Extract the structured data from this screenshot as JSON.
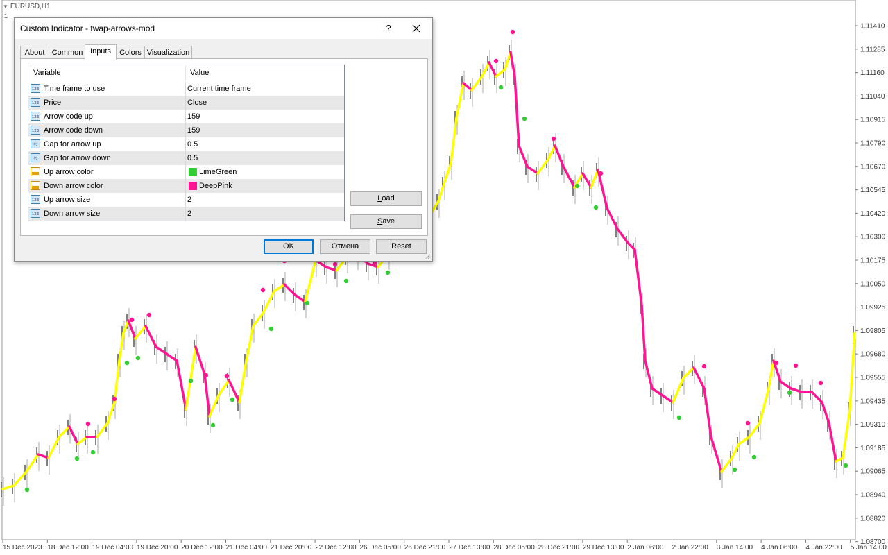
{
  "chart": {
    "symbol_title": "EURUSD,H1",
    "subwindow_label": "1",
    "colors": {
      "up": "#ffff00",
      "down": "#ff1493",
      "neutral": "#808080",
      "dot_up": "#32cd32",
      "dot_down": "#ff1493"
    },
    "price_labels": [
      "1.11410",
      "1.11285",
      "1.11160",
      "1.11040",
      "1.10915",
      "1.10790",
      "1.10670",
      "1.10545",
      "1.10420",
      "1.10300",
      "1.10175",
      "1.10050",
      "1.09925",
      "1.09805",
      "1.09680",
      "1.09555",
      "1.09435",
      "1.09310",
      "1.09185",
      "1.09065",
      "1.08940",
      "1.08820",
      "1.08700"
    ],
    "time_labels": [
      "15 Dec 2023",
      "18 Dec 12:00",
      "19 Dec 04:00",
      "19 Dec 20:00",
      "20 Dec 12:00",
      "21 Dec 04:00",
      "21 Dec 20:00",
      "22 Dec 12:00",
      "26 Dec 05:00",
      "26 Dec 21:00",
      "27 Dec 13:00",
      "28 Dec 05:00",
      "28 Dec 21:00",
      "29 Dec 13:00",
      "2 Jan 06:00",
      "2 Jan 22:00",
      "3 Jan 14:00",
      "4 Jan 06:00",
      "4 Jan 22:00",
      "5 Jan 14:00"
    ]
  },
  "dialog": {
    "title": "Custom Indicator - twap-arrows-mod",
    "help": "?",
    "tabs": [
      {
        "label": "About"
      },
      {
        "label": "Common"
      },
      {
        "label": "Inputs"
      },
      {
        "label": "Colors"
      },
      {
        "label": "Visualization"
      }
    ],
    "active_tab": "Inputs",
    "columns": {
      "variable": "Variable",
      "value": "Value"
    },
    "rows": [
      {
        "icon": "int-icon",
        "variable": "Time frame to use",
        "value": "Current time frame"
      },
      {
        "icon": "int-icon",
        "variable": "Price",
        "value": "Close"
      },
      {
        "icon": "int-icon",
        "variable": "Arrow code up",
        "value": "159"
      },
      {
        "icon": "int-icon",
        "variable": "Arrow code down",
        "value": "159"
      },
      {
        "icon": "double-icon",
        "variable": "Gap for arrow up",
        "value": "0.5"
      },
      {
        "icon": "double-icon",
        "variable": "Gap for arrow down",
        "value": "0.5"
      },
      {
        "icon": "color-icon",
        "variable": "Up arrow color",
        "value": "LimeGreen",
        "swatch": "#32cd32"
      },
      {
        "icon": "color-icon",
        "variable": "Down arrow color",
        "value": "DeepPink",
        "swatch": "#ff1493"
      },
      {
        "icon": "int-icon",
        "variable": "Up arrow size",
        "value": "2"
      },
      {
        "icon": "int-icon",
        "variable": "Down arrow size",
        "value": "2"
      }
    ],
    "buttons": {
      "load": {
        "accel": "L",
        "rest": "oad"
      },
      "save": {
        "accel": "S",
        "rest": "ave"
      },
      "ok": "OK",
      "cancel": "Отмена",
      "reset": "Reset"
    }
  }
}
